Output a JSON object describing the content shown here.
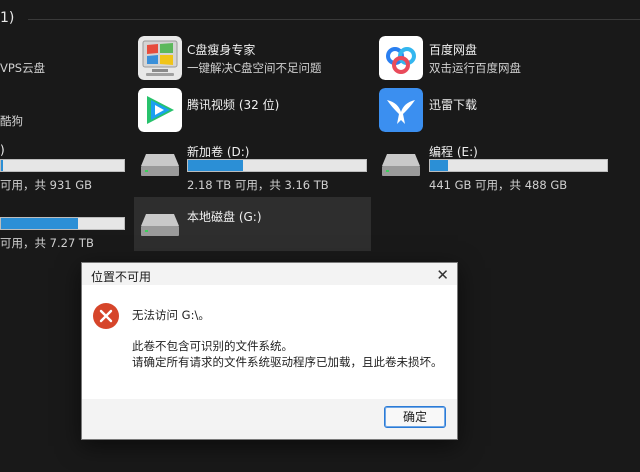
{
  "header": {
    "fragment": "1)"
  },
  "apps": [
    {
      "name": "C盘瘦身专家",
      "desc": "一键解决C盘空间不足问题",
      "icon": "windows-logo-icon"
    },
    {
      "name": "百度网盘",
      "desc": "双击运行百度网盘",
      "icon": "baidu-netdisk-icon"
    },
    {
      "name": "腾讯视频 (32 位)",
      "icon": "tencent-video-icon"
    },
    {
      "name": "迅雷下载",
      "icon": "xunlei-icon"
    }
  ],
  "left_fragments": {
    "app1": "VPS云盘",
    "app2": "酷狗",
    "drive1_name": ")",
    "drive1_space": "可用，共 931 GB",
    "drive2_space": "可用，共 7.27 TB"
  },
  "drives": [
    {
      "name": "新加卷 (D:)",
      "space": "2.18 TB 可用，共 3.16 TB",
      "used_fraction": 0.31
    },
    {
      "name": "编程 (E:)",
      "space": "441 GB 可用，共 488 GB",
      "used_fraction": 0.1
    },
    {
      "name": "本地磁盘 (G:)"
    }
  ],
  "left_bars": [
    {
      "used_fraction": 0.02
    },
    {
      "used_fraction": 0.63
    }
  ],
  "dialog": {
    "title": "位置不可用",
    "close_glyph": "✕",
    "line1": "无法访问 G:\\。",
    "line2": "此卷不包含可识别的文件系统。",
    "line3": "请确定所有请求的文件系统驱动程序已加载，且此卷未损坏。",
    "ok_label": "确定"
  },
  "colors": {
    "accent": "#2b8fd6",
    "error": "#d6452a"
  }
}
